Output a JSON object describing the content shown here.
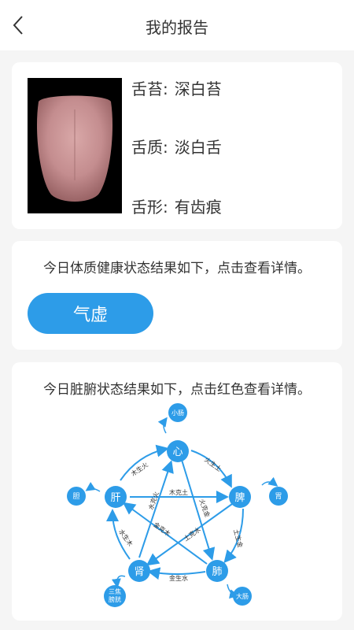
{
  "header": {
    "title": "我的报告"
  },
  "tongue": {
    "coating_label": "舌苔",
    "coating_value": "深白苔",
    "body_label": "舌质",
    "body_value": "淡白舌",
    "shape_label": "舌形",
    "shape_value": "有齿痕"
  },
  "constitution": {
    "description": "今日体质健康状态结果如下，点击查看详情。",
    "result": "气虚"
  },
  "organs": {
    "description": "今日脏腑状态结果如下，点击红色查看详情。",
    "main": {
      "heart": "心",
      "spleen": "脾",
      "lung": "肺",
      "kidney": "肾",
      "liver": "肝"
    },
    "paired": {
      "small_intestine": "小肠",
      "stomach": "胃",
      "large_intestine": "大肠",
      "bladder_1": "三焦",
      "bladder_2": "膀胱",
      "gallbladder": "胆"
    },
    "relations": {
      "wood_fire": "木生火",
      "fire_earth": "火生土",
      "earth_metal": "土生金",
      "metal_water": "金生水",
      "water_wood": "水生木",
      "wood_earth": "木克土",
      "fire_metal": "火克金",
      "water_fire": "水克火",
      "metal_wood": "金克木",
      "earth_water": "土克水"
    },
    "colors": {
      "node": "#2d9ce8",
      "line": "#2d9ce8"
    }
  }
}
